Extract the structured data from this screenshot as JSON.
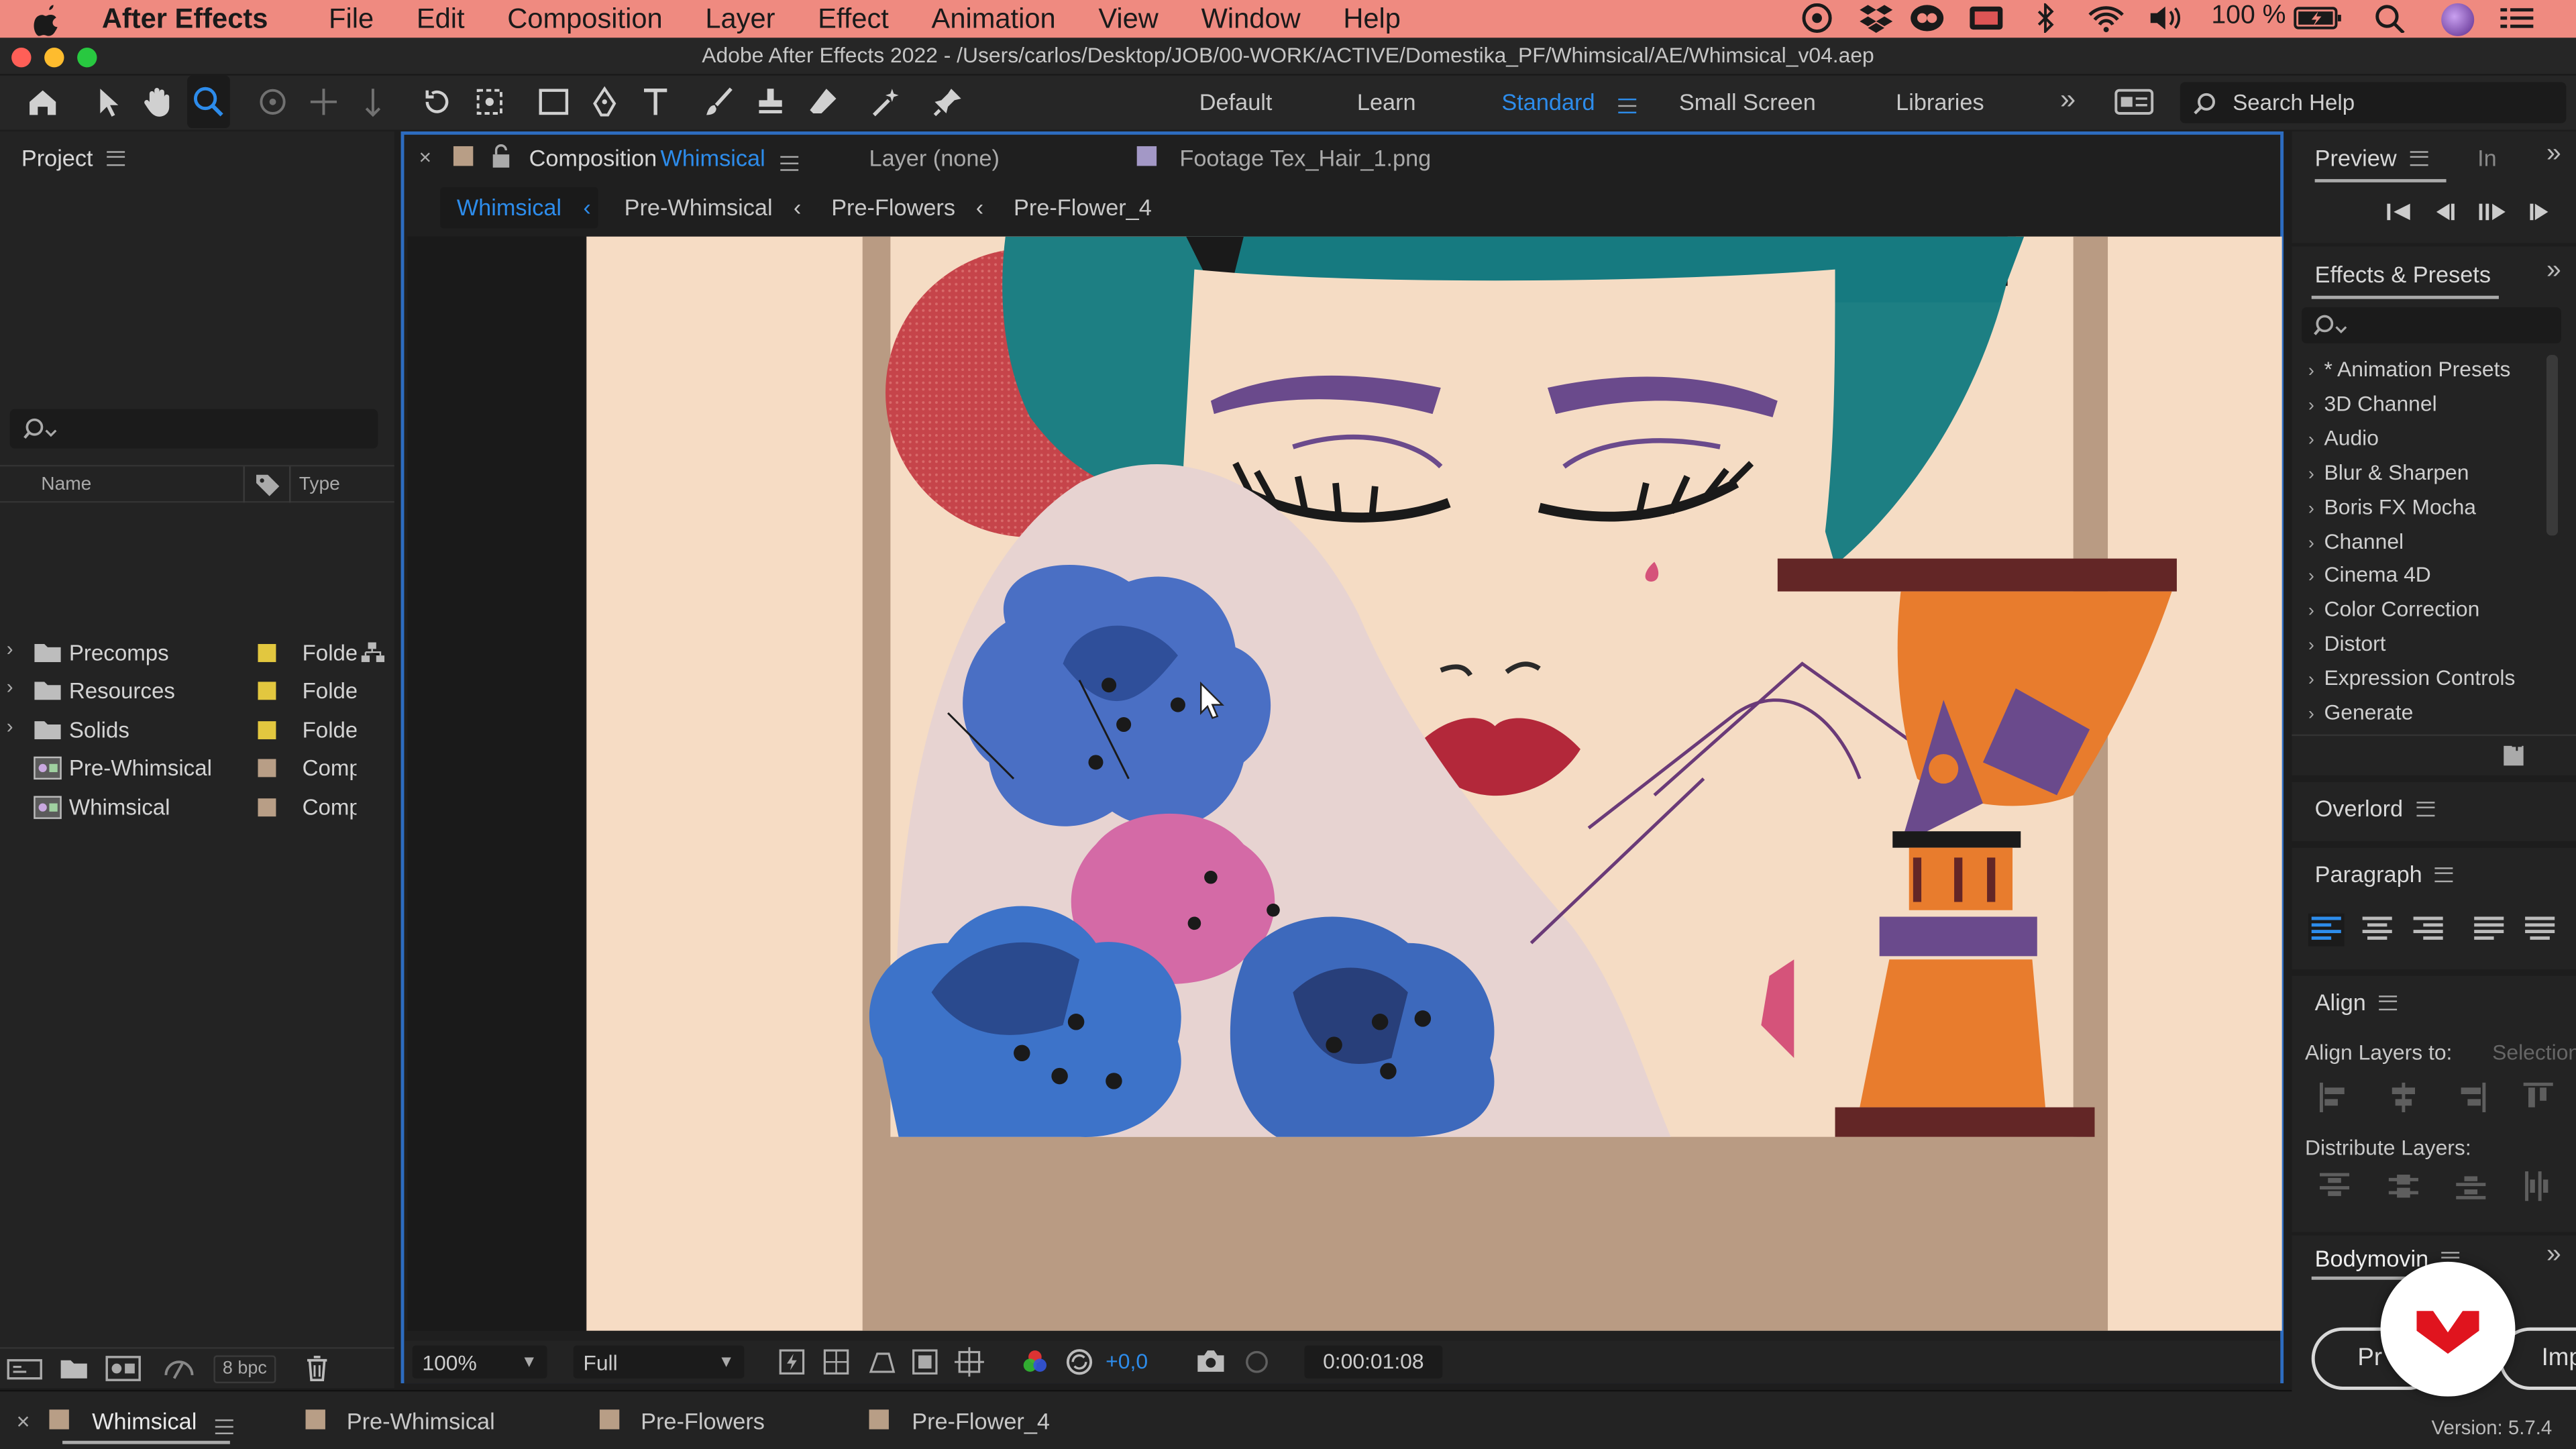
{
  "menubar": {
    "apple": "",
    "app_name": "After Effects",
    "items": [
      "File",
      "Edit",
      "Composition",
      "Layer",
      "Effect",
      "Animation",
      "View",
      "Window",
      "Help"
    ],
    "battery_percent": "100 %"
  },
  "window_title": "Adobe After Effects 2022 - /Users/carlos/Desktop/JOB/00-WORK/ACTIVE/Domestika_PF/Whimsical/AE/Whimsical_v04.aep",
  "workspaces": {
    "items": [
      "Default",
      "Learn",
      "Standard",
      "Small Screen",
      "Libraries"
    ],
    "active": "Standard",
    "search_placeholder": "Search Help"
  },
  "project": {
    "title": "Project",
    "search_placeholder": "",
    "col_name": "Name",
    "col_type": "Type",
    "items": [
      {
        "name": "Precomps",
        "type": "Folde",
        "kind": "folder",
        "color": "#e2c73f"
      },
      {
        "name": "Resources",
        "type": "Folde",
        "kind": "folder",
        "color": "#e2c73f"
      },
      {
        "name": "Solids",
        "type": "Folde",
        "kind": "folder",
        "color": "#e2c73f"
      },
      {
        "name": "Pre-Whimsical",
        "type": "Comp",
        "kind": "comp",
        "color": "#b89e86"
      },
      {
        "name": "Whimsical",
        "type": "Comp",
        "kind": "comp",
        "color": "#b89e86"
      }
    ],
    "bpc": "8 bpc"
  },
  "viewer": {
    "tab_prefix": "Composition",
    "tab_name": "Whimsical",
    "layer_tab": "Layer (none)",
    "footage_tab": "Footage Tex_Hair_1.png",
    "breadcrumbs": [
      "Whimsical",
      "Pre-Whimsical",
      "Pre-Flowers",
      "Pre-Flower_4"
    ],
    "zoom": "100%",
    "resolution": "Full",
    "exposure": "+0,0",
    "timecode": "0:00:01:08"
  },
  "preview": {
    "title": "Preview",
    "next_tab": "In"
  },
  "effects": {
    "title": "Effects & Presets",
    "items": [
      "* Animation Presets",
      "3D Channel",
      "Audio",
      "Blur & Sharpen",
      "Boris FX Mocha",
      "Channel",
      "Cinema 4D",
      "Color Correction",
      "Distort",
      "Expression Controls",
      "Generate"
    ]
  },
  "overlord": {
    "title": "Overlord"
  },
  "paragraph": {
    "title": "Paragraph"
  },
  "align": {
    "title": "Align",
    "align_to_label": "Align Layers to:",
    "align_to_value": "Selection",
    "distribute_label": "Distribute Layers:"
  },
  "bodymovin": {
    "title": "Bodymovin",
    "btn1": "Pr",
    "btn2": "Imp",
    "version": "Version: 5.7.4"
  },
  "timeline_tabs": [
    "Whimsical",
    "Pre-Whimsical",
    "Pre-Flowers",
    "Pre-Flower_4"
  ],
  "colors": {
    "menubar": "#ef8a80",
    "accent": "#2d8ceb",
    "panel": "#232323",
    "background": "#1d1d1d"
  }
}
